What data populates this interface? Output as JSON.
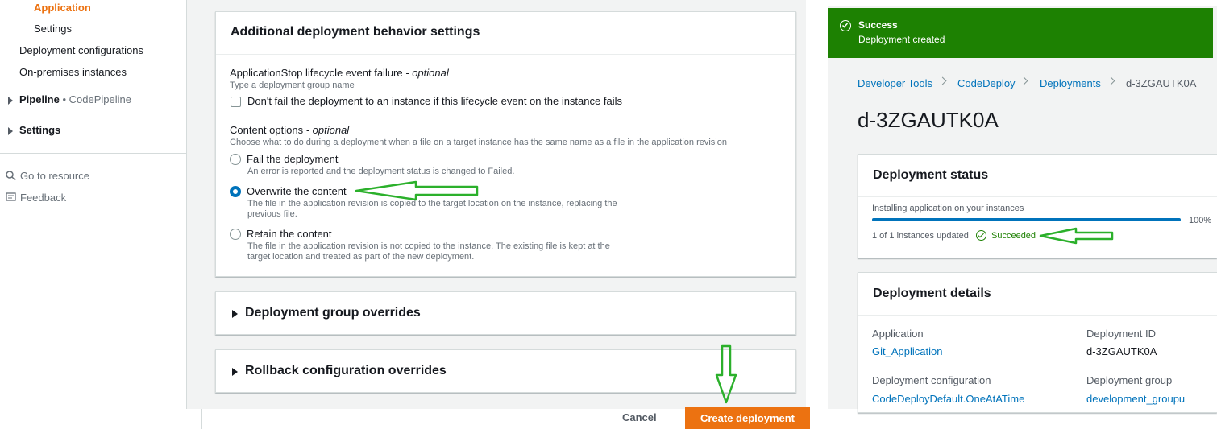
{
  "sidebar": {
    "active_item": "Application",
    "items": [
      "Settings",
      "Deployment configurations",
      "On-premises instances"
    ],
    "pipeline_label": "Pipeline",
    "pipeline_sub": "CodePipeline",
    "settings_label": "Settings",
    "go_to_resource": "Go to resource",
    "feedback": "Feedback"
  },
  "behavior_card": {
    "title": "Additional deployment behavior settings",
    "appstop_label": "ApplicationStop lifecycle event failure",
    "optional": "- optional",
    "appstop_hint": "Type a deployment group name",
    "appstop_checkbox": "Don't fail the deployment to an instance if this lifecycle event on the instance fails",
    "content_label": "Content options",
    "content_hint": "Choose what to do during a deployment when a file on a target instance has the same name as a file in the application revision",
    "options": [
      {
        "label": "Fail the deployment",
        "desc": "An error is reported and the deployment status is changed to Failed."
      },
      {
        "label": "Overwrite the content",
        "desc": "The file in the application revision is copied to the target location on the instance, replacing the previous file."
      },
      {
        "label": "Retain the content",
        "desc": "The file in the application revision is not copied to the instance. The existing file is kept at the target location and treated as part of the new deployment."
      }
    ],
    "selected_option": "Overwrite the content"
  },
  "group_overrides_title": "Deployment group overrides",
  "rollback_overrides_title": "Rollback configuration overrides",
  "footer": {
    "cancel": "Cancel",
    "create": "Create deployment"
  },
  "flash": {
    "title": "Success",
    "message": "Deployment created"
  },
  "breadcrumb": [
    "Developer Tools",
    "CodeDeploy",
    "Deployments",
    "d-3ZGAUTK0A"
  ],
  "page_title": "d-3ZGAUTK0A",
  "status_card": {
    "title": "Deployment status",
    "step": "Installing application on your instances",
    "progress_percent": 100,
    "progress_label": "100%",
    "instances_updated": "1 of 1 instances updated",
    "status": "Succeeded"
  },
  "details_card": {
    "title": "Deployment details",
    "application_label": "Application",
    "application_value": "Git_Application",
    "deployment_id_label": "Deployment ID",
    "deployment_id_value": "d-3ZGAUTK0A",
    "config_label": "Deployment configuration",
    "config_value": "CodeDeployDefault.OneAtATime",
    "group_label": "Deployment group",
    "group_value": "development_groupu"
  },
  "colors": {
    "accent_orange": "#ec7211",
    "link_blue": "#0073bb",
    "success_green": "#1d8102",
    "annotation_arrow": "#2bb02b"
  }
}
